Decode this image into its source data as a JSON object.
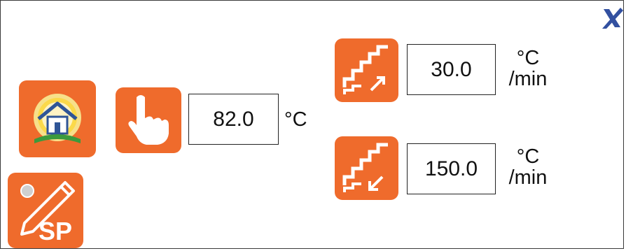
{
  "colors": {
    "accent": "#ef6b2c",
    "close": "#3250a0"
  },
  "icons": {
    "home_button": "home-sun-icon",
    "manual_button": "hand-pointer-icon",
    "ramp_up_button": "stairs-up-icon",
    "ramp_down_button": "stairs-down-icon",
    "setpoint_button": "pencil-sp-icon",
    "close_button": "close-icon"
  },
  "setpoint": {
    "value": "82.0",
    "unit": "°C"
  },
  "ramp_up": {
    "value": "30.0",
    "unit_top": "°C",
    "unit_bottom": "/min"
  },
  "ramp_down": {
    "value": "150.0",
    "unit_top": "°C",
    "unit_bottom": "/min"
  },
  "sp_badge": "SP"
}
